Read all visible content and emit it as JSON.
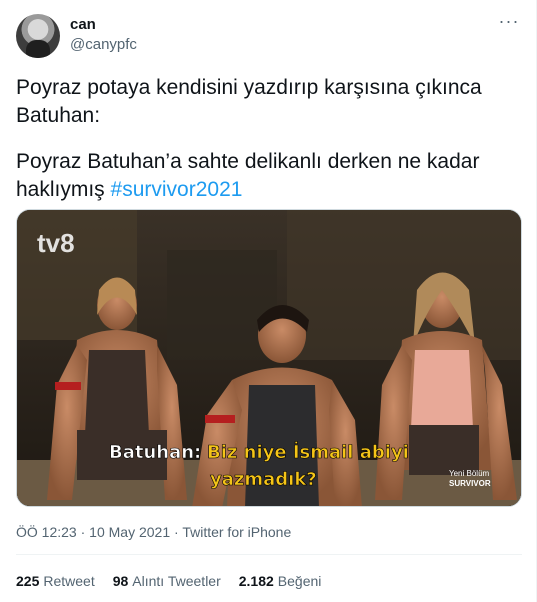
{
  "user": {
    "display_name": "can",
    "handle": "@canypfc"
  },
  "more_icon": "more-horizontal-icon",
  "tweet": {
    "line1": "Poyraz potaya kendisini yazdırıp karşısına çıkınca Batuhan:",
    "line2_text": "Poyraz Batuhan’a sahte delikanlı derken ne kadar haklıymış ",
    "hashtag": "#survivor2021"
  },
  "media": {
    "channel_logo": "tv8",
    "subtitle_speaker": "Batuhan:",
    "subtitle_line1": "Biz niye İsmail abiyi",
    "subtitle_line2": "yazmadık?",
    "corner_text1": "Yeni Bölüm",
    "corner_text2": "SURVIVOR"
  },
  "meta": {
    "time": "ÖÖ 12:23",
    "separator": "·",
    "date": "10 May 2021",
    "source": "Twitter for iPhone"
  },
  "stats": [
    {
      "count": "225",
      "label": "Retweet"
    },
    {
      "count": "98",
      "label": "Alıntı Tweetler"
    },
    {
      "count": "2.182",
      "label": "Beğeni"
    }
  ],
  "colors": {
    "link": "#1d9bf0",
    "subtitle_yellow": "#f5c518",
    "text_secondary": "#536471"
  }
}
